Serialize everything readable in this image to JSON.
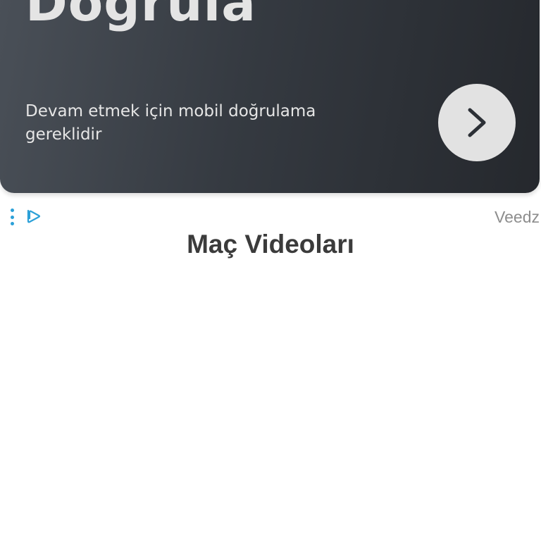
{
  "ad": {
    "title": "Doğrula",
    "text": "Devam etmek için mobil doğrulama gereklidir",
    "brand": "Veedz",
    "next_icon": "chevron-right-icon",
    "options_icon": "kebab-menu-icon",
    "adchoices_icon": "adchoices-icon",
    "colors": {
      "background": "#353a41",
      "button": "#e2e2e2",
      "accent": "#2ba0d8"
    }
  },
  "main": {
    "section_title": "Maç Videoları"
  }
}
